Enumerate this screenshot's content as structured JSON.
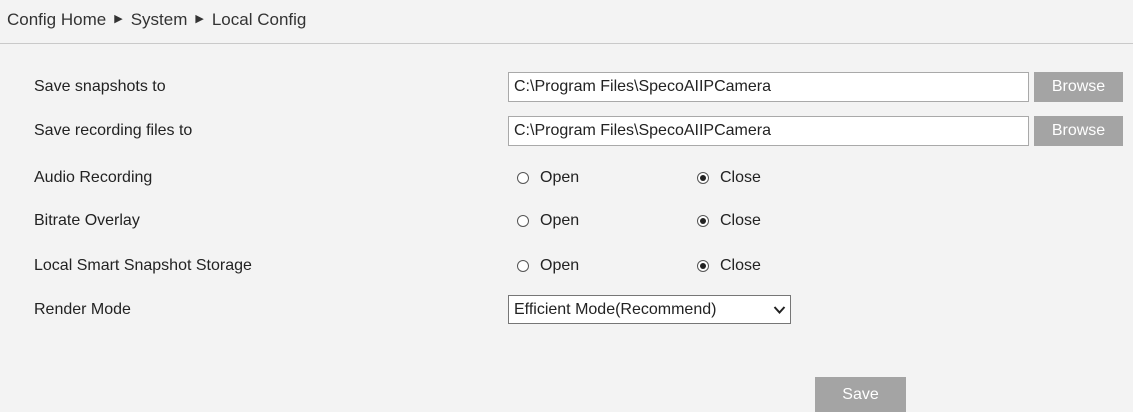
{
  "breadcrumb": {
    "items": [
      "Config Home",
      "System",
      "Local Config"
    ],
    "separator": "▶"
  },
  "snapshots": {
    "label": "Save snapshots to",
    "value": "C:\\Program Files\\SpecoAIIPCamera",
    "button": "Browse"
  },
  "recordings": {
    "label": "Save recording files to",
    "value": "C:\\Program Files\\SpecoAIIPCamera",
    "button": "Browse"
  },
  "audio_recording": {
    "label": "Audio Recording",
    "open": "Open",
    "close": "Close",
    "selected": "close"
  },
  "bitrate_overlay": {
    "label": "Bitrate Overlay",
    "open": "Open",
    "close": "Close",
    "selected": "close"
  },
  "smart_snapshot": {
    "label": "Local Smart Snapshot Storage",
    "open": "Open",
    "close": "Close",
    "selected": "close"
  },
  "render_mode": {
    "label": "Render Mode",
    "value": "Efficient Mode(Recommend)"
  },
  "save_button": "Save",
  "colors": {
    "background": "#f3f3f3",
    "button": "#a4a4a4",
    "button_text": "#ffffff",
    "divider": "#c9c9c9"
  },
  "icons": {
    "breadcrumb_separator": "triangle-right-icon",
    "select_arrow": "chevron-down-icon"
  }
}
